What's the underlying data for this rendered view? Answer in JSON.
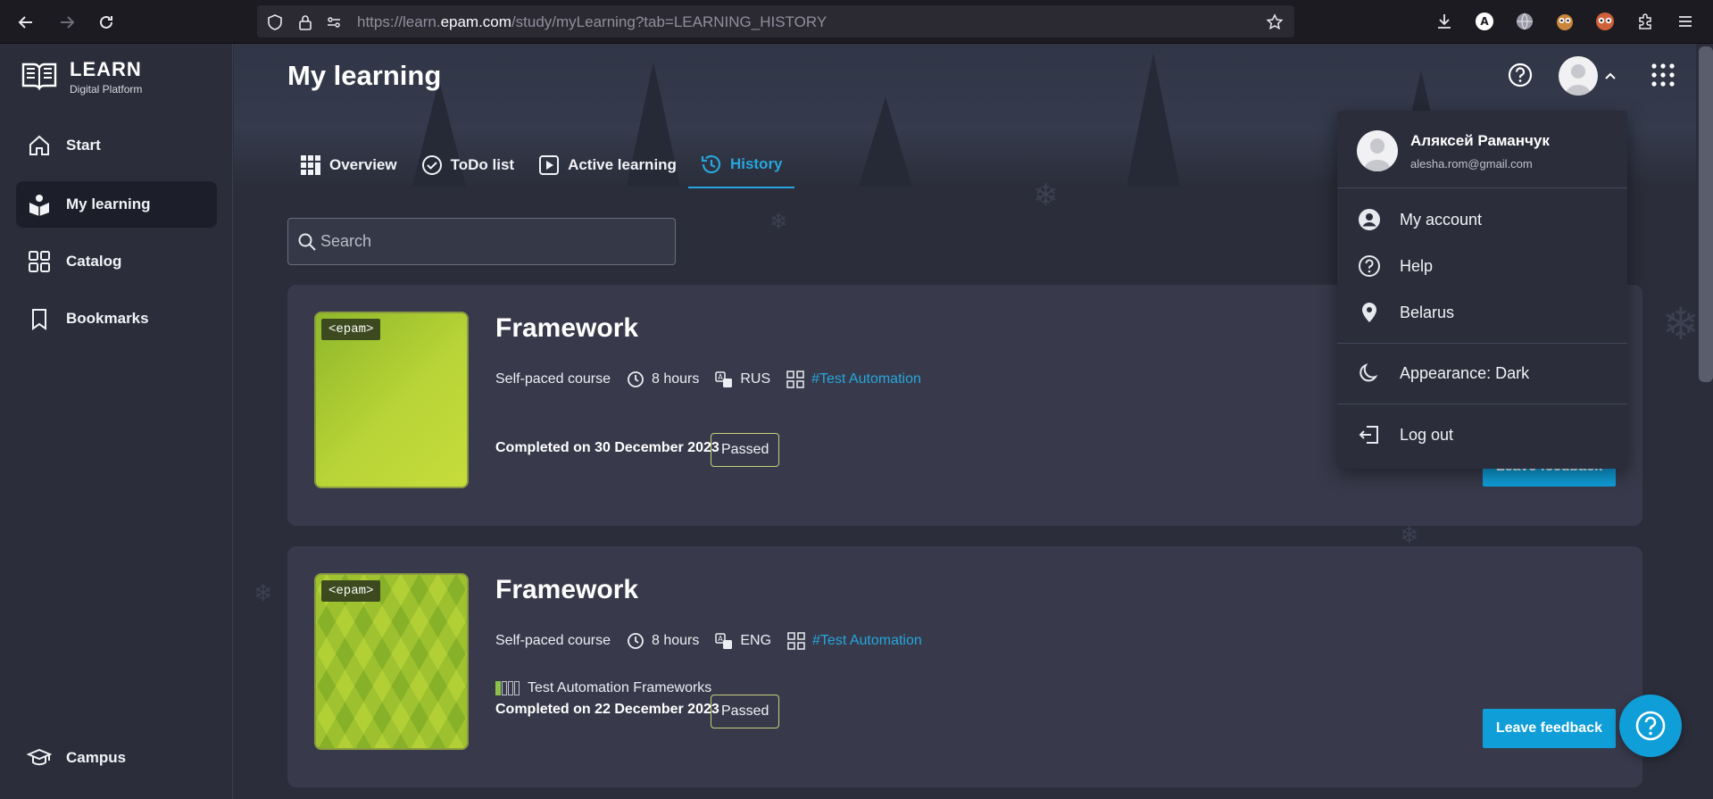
{
  "browser": {
    "url_prefix": "https://learn.",
    "url_domain": "epam.com",
    "url_path": "/study/myLearning?tab=LEARNING_HISTORY"
  },
  "sidebar": {
    "logo_title": "LEARN",
    "logo_subtitle": "Digital Platform",
    "items": [
      {
        "label": "Start"
      },
      {
        "label": "My learning"
      },
      {
        "label": "Catalog"
      },
      {
        "label": "Bookmarks"
      }
    ],
    "campus_label": "Campus"
  },
  "header": {
    "title": "My learning"
  },
  "tabs": [
    {
      "label": "Overview"
    },
    {
      "label": "ToDo list"
    },
    {
      "label": "Active learning"
    },
    {
      "label": "History"
    }
  ],
  "search": {
    "placeholder": "Search"
  },
  "courses": [
    {
      "logo": "<epam>",
      "title": "Framework",
      "type": "Self-paced course",
      "duration": "8 hours",
      "language": "RUS",
      "tag": "#Test Automation",
      "completed": "Completed on 30 December 2023",
      "status": "Passed",
      "feedback": "Leave feedback"
    },
    {
      "logo": "<epam>",
      "title": "Framework",
      "type": "Self-paced course",
      "duration": "8 hours",
      "language": "ENG",
      "tag": "#Test Automation",
      "program": "Test Automation Frameworks",
      "completed": "Completed on 22 December 2023",
      "status": "Passed",
      "feedback": "Leave feedback"
    }
  ],
  "user_menu": {
    "name": "Аляксей Раманчук",
    "email": "alesha.rom@gmail.com",
    "items": [
      {
        "label": "My account"
      },
      {
        "label": "Help"
      },
      {
        "label": "Belarus"
      },
      {
        "label": "Appearance: Dark"
      },
      {
        "label": "Log out"
      }
    ]
  },
  "colors": {
    "accent": "#26a6dc",
    "button": "#0f9ed8",
    "background": "#2b2d3a",
    "card": "#383a4b"
  }
}
